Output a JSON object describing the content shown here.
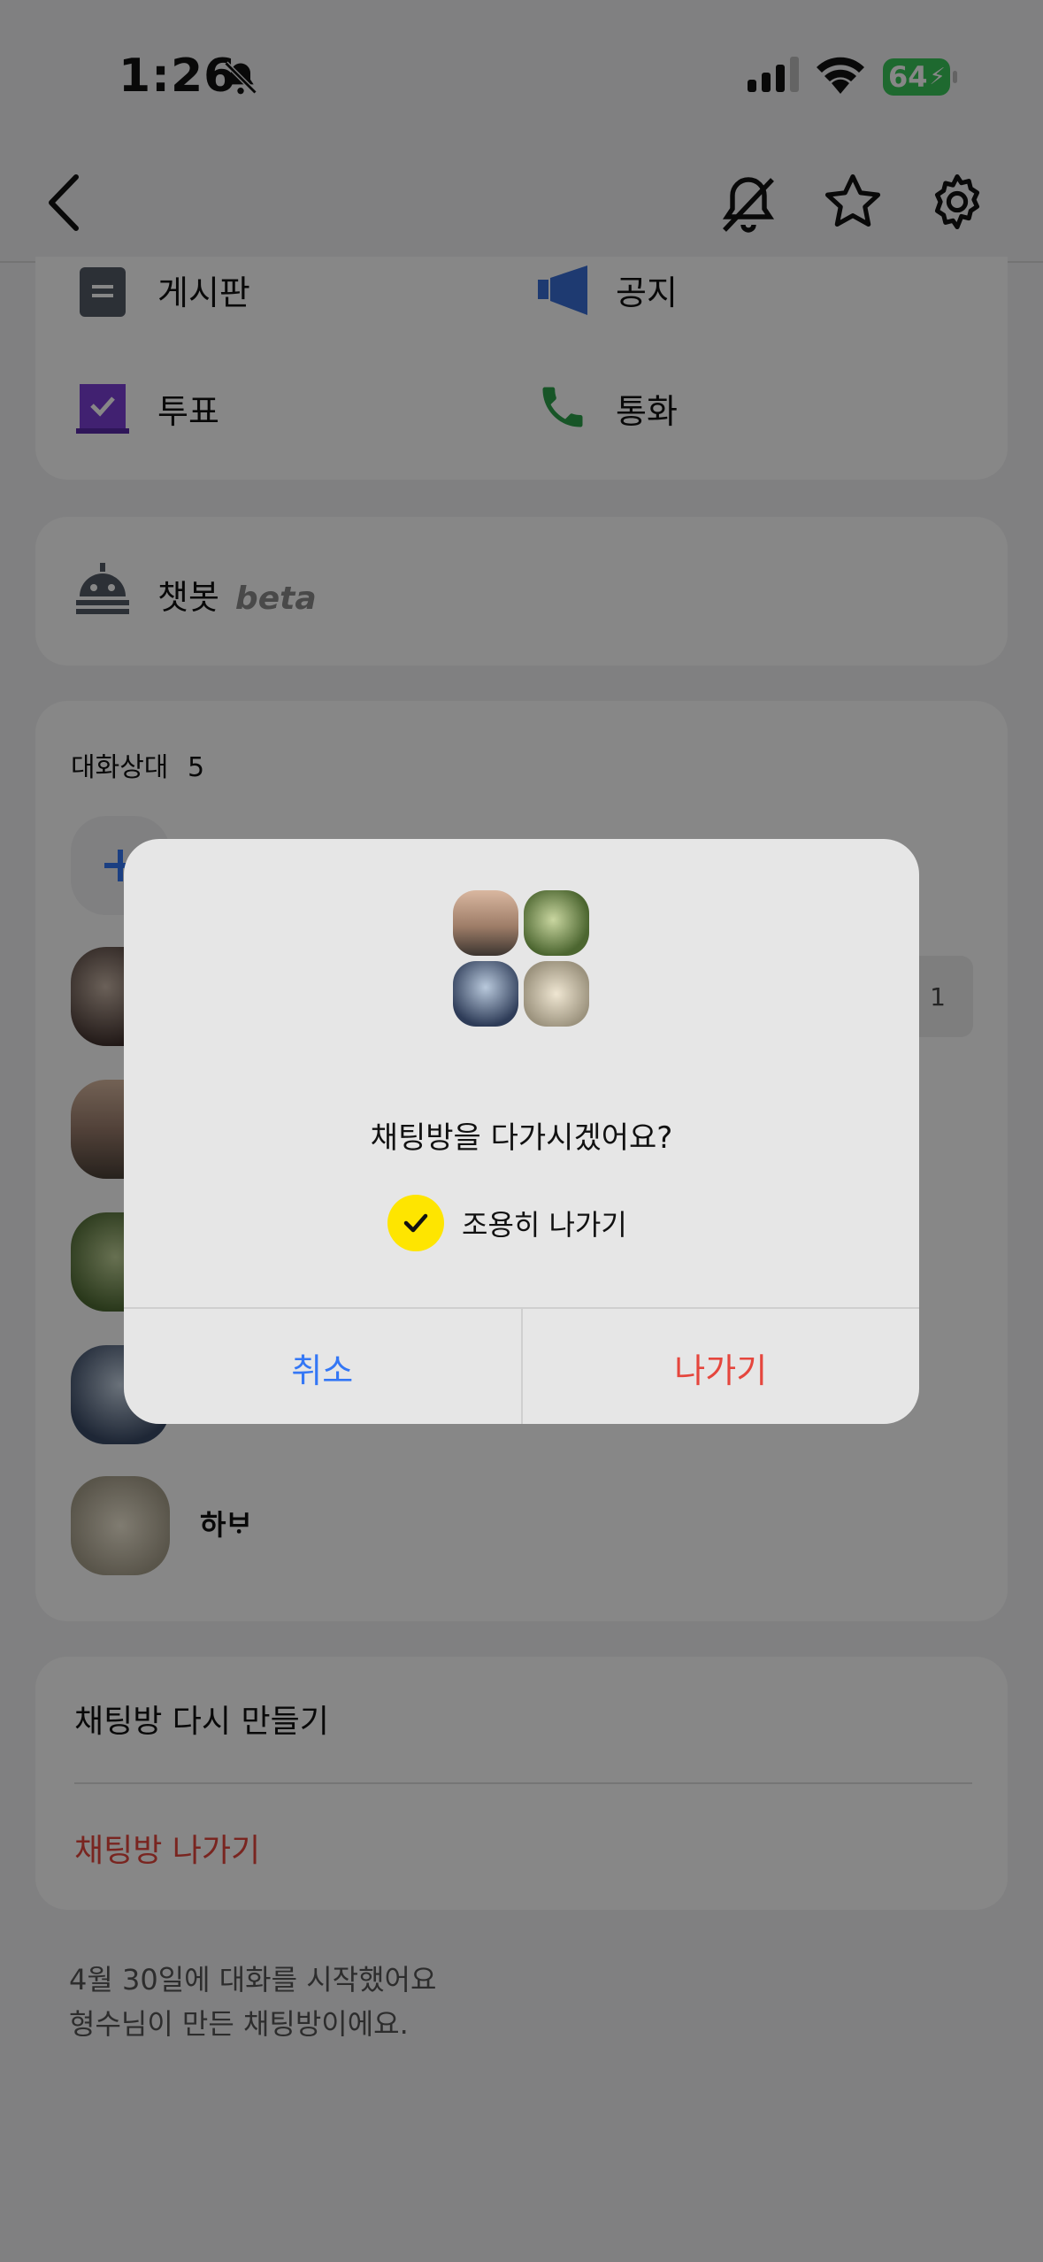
{
  "status": {
    "time": "1:26",
    "battery": "64"
  },
  "features": [
    {
      "label": "게시판",
      "icon": "board-icon"
    },
    {
      "label": "공지",
      "icon": "megaphone-icon"
    },
    {
      "label": "투표",
      "icon": "vote-icon"
    },
    {
      "label": "통화",
      "icon": "phone-icon"
    }
  ],
  "chatbot": {
    "label": "챗봇",
    "badge": "beta"
  },
  "members": {
    "header": "대화상대",
    "count": "5",
    "unread_badge": "1",
    "last_member_name": "하ᄇᆞ"
  },
  "actions": {
    "recreate": "채팅방 다시 만들기",
    "leave": "채팅방 나가기"
  },
  "footer": {
    "line1": "4월 30일에 대화를 시작했어요",
    "line2": "형수님이 만든 채팅방이에요."
  },
  "dialog": {
    "title": "채팅방을 다가시겠어요?",
    "quiet_leave": "조용히 나가기",
    "cancel": "취소",
    "confirm": "나가기"
  },
  "colors": {
    "accent_blue": "#3477f5",
    "danger_red": "#e5463d",
    "kakao_yellow": "#fee500",
    "battery_green": "#39c759"
  }
}
